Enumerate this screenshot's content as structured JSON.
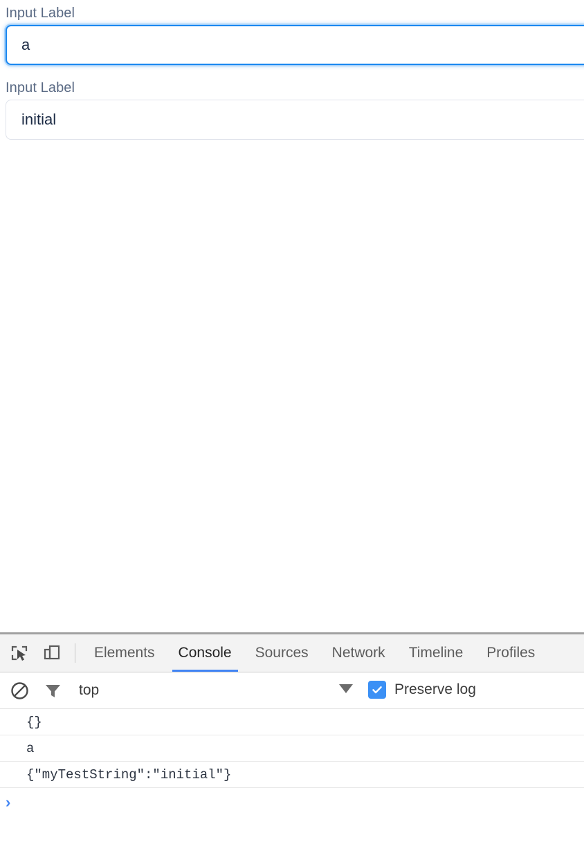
{
  "page": {
    "fields": [
      {
        "label": "Input Label",
        "value": "a",
        "placeholder": "",
        "focused": true
      },
      {
        "label": "Input Label",
        "value": "initial",
        "placeholder": "",
        "focused": false
      }
    ]
  },
  "devtools": {
    "tabs": [
      {
        "label": "Elements",
        "active": false
      },
      {
        "label": "Console",
        "active": true
      },
      {
        "label": "Sources",
        "active": false
      },
      {
        "label": "Network",
        "active": false
      },
      {
        "label": "Timeline",
        "active": false
      },
      {
        "label": "Profiles",
        "active": false
      }
    ],
    "toolbar_icons": [
      {
        "name": "inspect-element-icon"
      },
      {
        "name": "device-toolbar-icon"
      }
    ],
    "filterbar": {
      "clear_icon": "clear-console-icon",
      "filter_icon": "filter-icon",
      "context": "top",
      "preserve_log_label": "Preserve log",
      "preserve_log_checked": true
    },
    "console": {
      "messages": [
        "{}",
        "a",
        "{\"myTestString\":\"initial\"}"
      ],
      "prompt_symbol": "›",
      "prompt_value": ""
    }
  },
  "colors": {
    "accent_blue": "#4285f4",
    "focus_blue": "#1a87f0",
    "checkbox_blue": "#3b90f5",
    "label_slate": "#5a6a84",
    "console_text": "#2b3340",
    "tab_inactive": "#5c5c5c",
    "tab_active": "#222222"
  }
}
